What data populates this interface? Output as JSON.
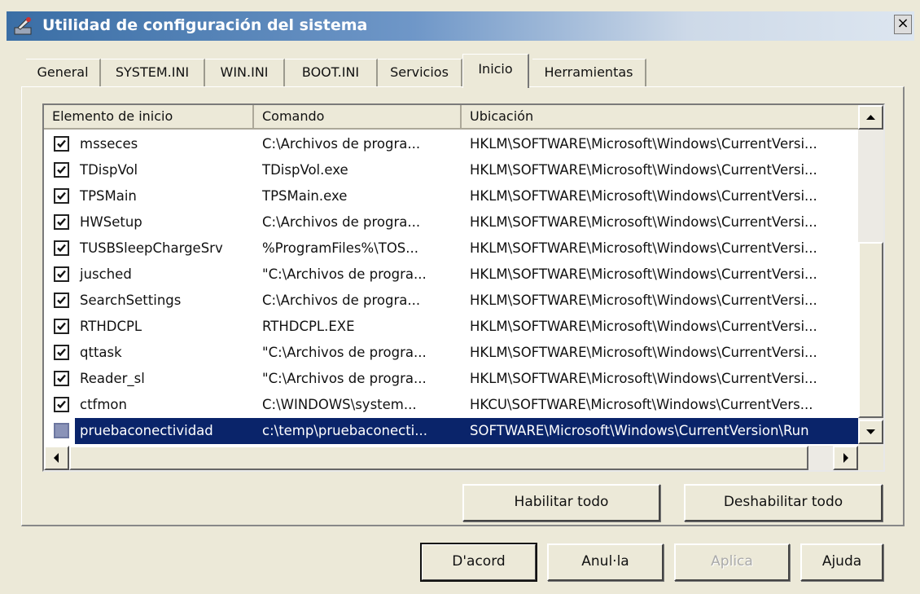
{
  "window": {
    "title": "Utilidad de configuración del sistema",
    "close_label": "×"
  },
  "tabs": [
    {
      "label": "General",
      "active": false
    },
    {
      "label": "SYSTEM.INI",
      "active": false
    },
    {
      "label": "WIN.INI",
      "active": false
    },
    {
      "label": "BOOT.INI",
      "active": false
    },
    {
      "label": "Servicios",
      "active": false
    },
    {
      "label": "Inicio",
      "active": true
    },
    {
      "label": "Herramientas",
      "active": false
    }
  ],
  "table": {
    "columns": [
      "Elemento de inicio",
      "Comando",
      "Ubicación"
    ],
    "rows": [
      {
        "checked": true,
        "name": "msseces",
        "command": "C:\\Archivos de progra...",
        "location": "HKLM\\SOFTWARE\\Microsoft\\Windows\\CurrentVersi..."
      },
      {
        "checked": true,
        "name": "TDispVol",
        "command": "TDispVol.exe",
        "location": "HKLM\\SOFTWARE\\Microsoft\\Windows\\CurrentVersi..."
      },
      {
        "checked": true,
        "name": "TPSMain",
        "command": "TPSMain.exe",
        "location": "HKLM\\SOFTWARE\\Microsoft\\Windows\\CurrentVersi..."
      },
      {
        "checked": true,
        "name": "HWSetup",
        "command": "C:\\Archivos de progra...",
        "location": "HKLM\\SOFTWARE\\Microsoft\\Windows\\CurrentVersi..."
      },
      {
        "checked": true,
        "name": "TUSBSleepChargeSrv",
        "command": "%ProgramFiles%\\TOS...",
        "location": "HKLM\\SOFTWARE\\Microsoft\\Windows\\CurrentVersi..."
      },
      {
        "checked": true,
        "name": "jusched",
        "command": "\"C:\\Archivos de progra...",
        "location": "HKLM\\SOFTWARE\\Microsoft\\Windows\\CurrentVersi..."
      },
      {
        "checked": true,
        "name": "SearchSettings",
        "command": "C:\\Archivos de progra...",
        "location": "HKLM\\SOFTWARE\\Microsoft\\Windows\\CurrentVersi..."
      },
      {
        "checked": true,
        "name": "RTHDCPL",
        "command": "RTHDCPL.EXE",
        "location": "HKLM\\SOFTWARE\\Microsoft\\Windows\\CurrentVersi..."
      },
      {
        "checked": true,
        "name": "qttask",
        "command": "\"C:\\Archivos de progra...",
        "location": "HKLM\\SOFTWARE\\Microsoft\\Windows\\CurrentVersi..."
      },
      {
        "checked": true,
        "name": "Reader_sl",
        "command": "\"C:\\Archivos de progra...",
        "location": "HKLM\\SOFTWARE\\Microsoft\\Windows\\CurrentVersi..."
      },
      {
        "checked": true,
        "name": "ctfmon",
        "command": "C:\\WINDOWS\\system...",
        "location": "HKCU\\SOFTWARE\\Microsoft\\Windows\\CurrentVers..."
      },
      {
        "checked": false,
        "selected": true,
        "name": "pruebaconectividad",
        "command": "c:\\temp\\pruebaconecti...",
        "location": "SOFTWARE\\Microsoft\\Windows\\CurrentVersion\\Run"
      }
    ]
  },
  "buttons": {
    "enable_all": "Habilitar todo",
    "disable_all": "Deshabilitar todo",
    "ok": "D'acord",
    "cancel": "Anul·la",
    "apply": "Aplica",
    "help": "Ajuda"
  },
  "colors": {
    "selection": "#0a246a",
    "face": "#ece9d8"
  }
}
